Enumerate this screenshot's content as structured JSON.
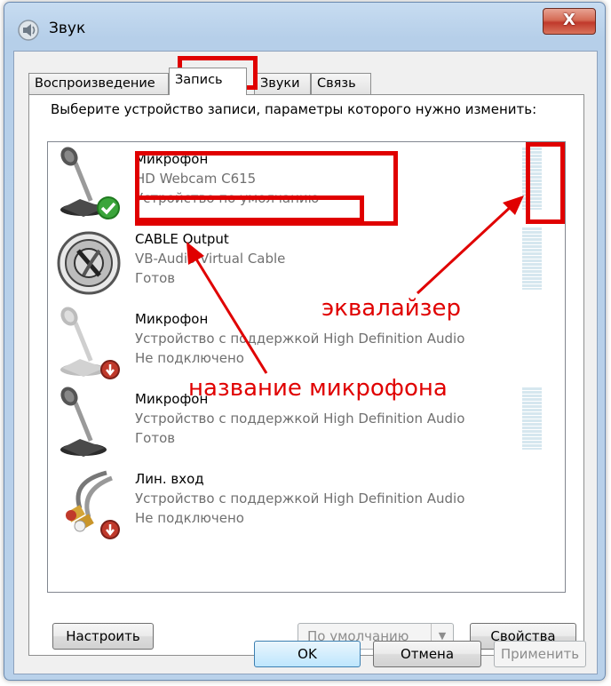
{
  "window": {
    "title": "Звук",
    "close_label": "X"
  },
  "tabs": [
    {
      "label": "Воспроизведение"
    },
    {
      "label": "Запись"
    },
    {
      "label": "Звуки"
    },
    {
      "label": "Связь"
    }
  ],
  "instructions": "Выберите устройство записи, параметры которого нужно изменить:",
  "devices": [
    {
      "name": "Микрофон",
      "description": "HD Webcam C615",
      "status": "Устройство по умолчанию",
      "icon": "microphone-default-icon"
    },
    {
      "name": "CABLE Output",
      "description": "VB-Audio Virtual Cable",
      "status": "Готов",
      "icon": "cable-icon"
    },
    {
      "name": "Микрофон",
      "description": "Устройство с поддержкой High Definition Audio",
      "status": "Не подключено",
      "icon": "microphone-disconnected-icon"
    },
    {
      "name": "Микрофон",
      "description": "Устройство с поддержкой High Definition Audio",
      "status": "Готов",
      "icon": "microphone-icon"
    },
    {
      "name": "Лин. вход",
      "description": "Устройство с поддержкой High Definition Audio",
      "status": "Не подключено",
      "icon": "line-in-disconnected-icon"
    }
  ],
  "buttons": {
    "configure": "Настроить",
    "set_default": "По умолчанию",
    "properties": "Свойства",
    "ok": "OK",
    "cancel": "Отмена",
    "apply": "Применить"
  },
  "annotations": {
    "equalizer": "эквалайзер",
    "mic_name": "название микрофона"
  },
  "colors": {
    "annotation": "#e00000",
    "status_text": "#707070"
  }
}
